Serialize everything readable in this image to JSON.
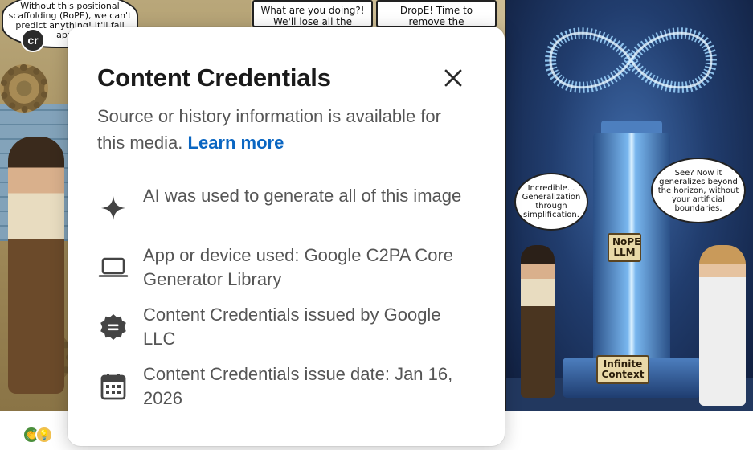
{
  "background_comic": {
    "panel1_bubble": "Without this positional scaffolding (RoPE), we can't predict anything! It'll fall apart!",
    "panel2_caption_a": "What are you doing?! We'll lose all the",
    "panel2_caption_b": "DropE! Time to remove the scaffolding. Let",
    "bubble_left": "Incredible... Generalization through simplification.",
    "bubble_right": "See? Now it generalizes beyond the horizon, without your artificial boundaries.",
    "sign_nope": "NoPE LLM",
    "sign_context": "Infinite Context",
    "cr_badge": "cr"
  },
  "popover": {
    "title": "Content Credentials",
    "intro_text": "Source or history information is available for this media.",
    "learn_more": "Learn more",
    "rows": [
      {
        "icon": "sparkle-icon",
        "text": "AI was used to generate all of this image"
      },
      {
        "icon": "laptop-icon",
        "text": "App or device used: Google C2PA Core Generator Library"
      },
      {
        "icon": "badge-icon",
        "text": "Content Credentials issued by Google LLC"
      },
      {
        "icon": "calendar-icon",
        "text": "Content Credentials issue date: Jan 16, 2026"
      }
    ]
  },
  "reactions": {
    "clap": "👏",
    "bulb": "💡"
  },
  "colors": {
    "link": "#0a66c2",
    "title": "#1a1a1a",
    "body_text": "#555555",
    "icon": "#444444"
  }
}
